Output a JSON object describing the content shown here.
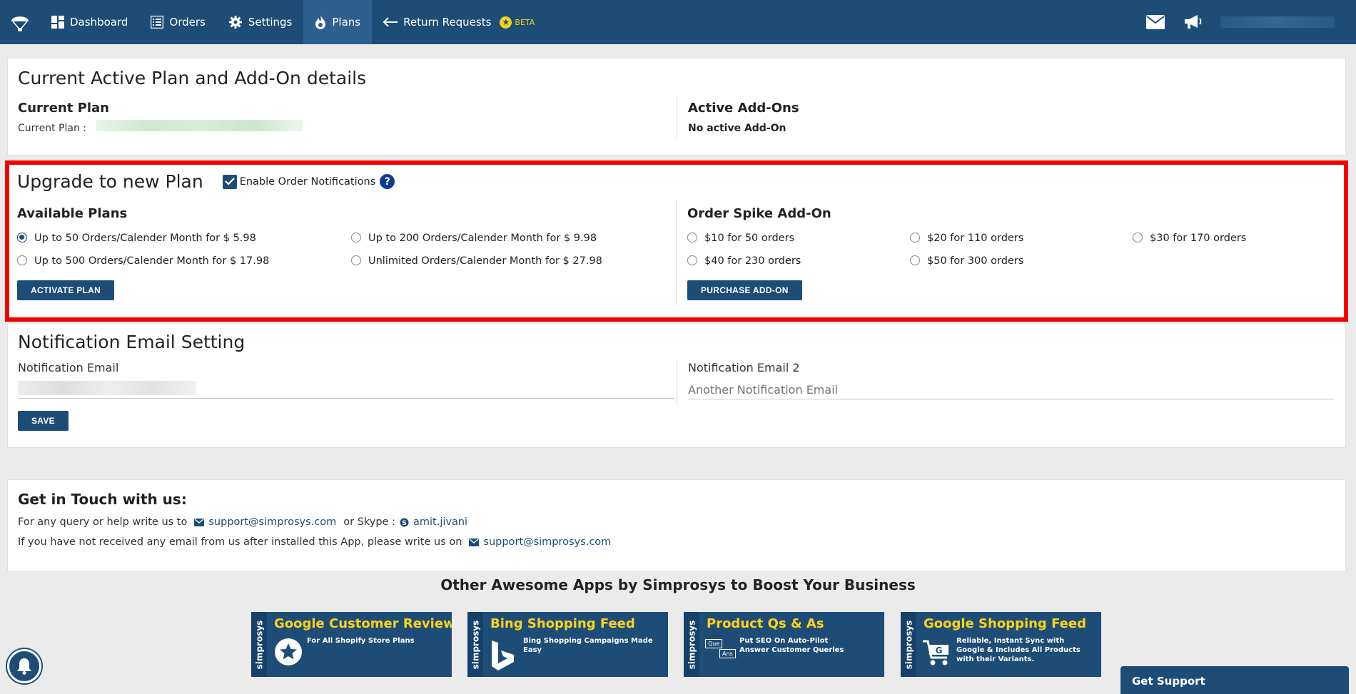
{
  "nav": {
    "items": [
      {
        "label": "Dashboard",
        "icon": "dashboard-icon"
      },
      {
        "label": "Orders",
        "icon": "list-icon"
      },
      {
        "label": "Settings",
        "icon": "gear-icon"
      },
      {
        "label": "Plans",
        "icon": "flame-icon",
        "active": true
      },
      {
        "label": "Return Requests",
        "icon": "return-arrow-icon"
      }
    ],
    "beta_label": "BETA"
  },
  "current_plan_card": {
    "title": "Current Active Plan and Add-On details",
    "current_plan_heading": "Current Plan",
    "current_plan_label": "Current Plan :",
    "addons_heading": "Active Add-Ons",
    "addons_value": "No active Add-On"
  },
  "upgrade_card": {
    "title": "Upgrade to new Plan",
    "notifications_label": "Enable Order Notifications",
    "help_glyph": "?",
    "plans_heading": "Available Plans",
    "plans": [
      "Up to 50 Orders/Calender Month for $ 5.98",
      "Up to 200 Orders/Calender Month for $ 9.98",
      "Up to 500 Orders/Calender Month for $ 17.98",
      "Unlimited Orders/Calender Month for $ 27.98"
    ],
    "activate_label": "ACTIVATE PLAN",
    "addon_heading": "Order Spike Add-On",
    "addons": [
      "$10 for 50 orders",
      "$20 for 110 orders",
      "$30 for 170 orders",
      "$40 for 230 orders",
      "$50 for 300 orders"
    ],
    "purchase_label": "PURCHASE ADD-ON"
  },
  "notification_card": {
    "title": "Notification Email Setting",
    "email_label": "Notification Email",
    "email2_label": "Notification Email 2",
    "email2_placeholder": "Another Notification Email",
    "save_label": "SAVE"
  },
  "contact_card": {
    "title": "Get in Touch with us:",
    "line1_prefix": "For any query or help write us to",
    "email": "support@simprosys.com",
    "skype_prefix": "or Skype :",
    "skype": "amit.jivani",
    "line2_prefix": "If you have not received any email from us after installed this App, please write us on",
    "email2": "support@simprosys.com"
  },
  "apps": {
    "title": "Other Awesome Apps by Simprosys to Boost Your Business",
    "brand": "simprosys",
    "items": [
      {
        "title": "Google Customer Reviews",
        "desc": "For All Shopify Store Plans"
      },
      {
        "title": "Bing Shopping Feed",
        "desc": "Bing Shopping Campaigns Made Easy"
      },
      {
        "title": "Product Qs & As",
        "desc": "Put SEO On Auto-Pilot Answer Customer Queries",
        "icon_q": "Que",
        "icon_a": "Ans"
      },
      {
        "title": "Google Shopping Feed",
        "desc": "Reliable, Instant Sync with Google & Includes All Products with their Variants."
      }
    ]
  },
  "support": {
    "label": "Get Support"
  }
}
